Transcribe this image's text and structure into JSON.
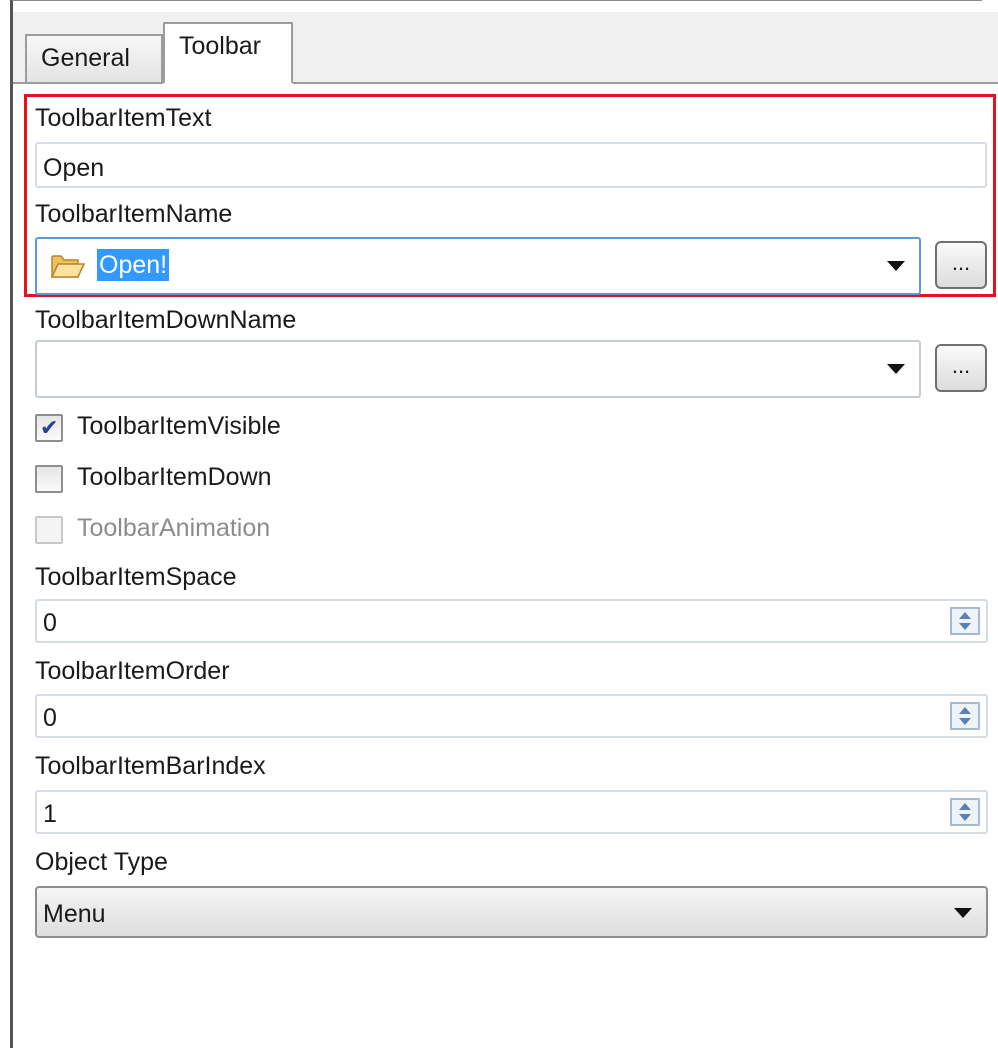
{
  "tabs": {
    "general": "General",
    "toolbar": "Toolbar"
  },
  "fields": {
    "item_text": {
      "label": "ToolbarItemText",
      "value": "Open"
    },
    "item_name": {
      "label": "ToolbarItemName",
      "value": "Open!",
      "icon": "folder-open-icon",
      "button": "..."
    },
    "item_down_name": {
      "label": "ToolbarItemDownName",
      "value": "",
      "button": "..."
    },
    "item_visible": {
      "label": "ToolbarItemVisible",
      "checked": true
    },
    "item_down": {
      "label": "ToolbarItemDown",
      "checked": false
    },
    "animation": {
      "label": "ToolbarAnimation",
      "checked": false,
      "enabled": false
    },
    "item_space": {
      "label": "ToolbarItemSpace",
      "value": "0"
    },
    "item_order": {
      "label": "ToolbarItemOrder",
      "value": "0"
    },
    "bar_index": {
      "label": "ToolbarItemBarIndex",
      "value": "1"
    },
    "object_type": {
      "label": "Object Type",
      "value": "Menu"
    }
  },
  "colors": {
    "highlight_border": "#e8101a",
    "selection": "#3399ff",
    "focus_border": "#5b9ad6"
  }
}
